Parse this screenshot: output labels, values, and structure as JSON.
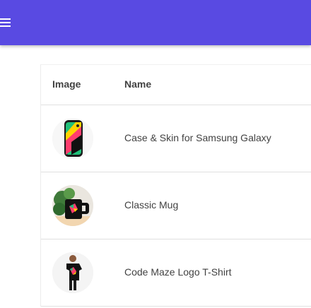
{
  "appbar": {
    "menu_icon": "hamburger-menu-icon",
    "color": "#594ae2"
  },
  "table": {
    "headers": {
      "image": "Image",
      "name": "Name"
    },
    "rows": [
      {
        "name": "Case & Skin for Samsung Galaxy",
        "image_icon": "phone-case-image"
      },
      {
        "name": "Classic Mug",
        "image_icon": "mug-image"
      },
      {
        "name": "Code Maze Logo T-Shirt",
        "image_icon": "tshirt-image"
      }
    ]
  }
}
